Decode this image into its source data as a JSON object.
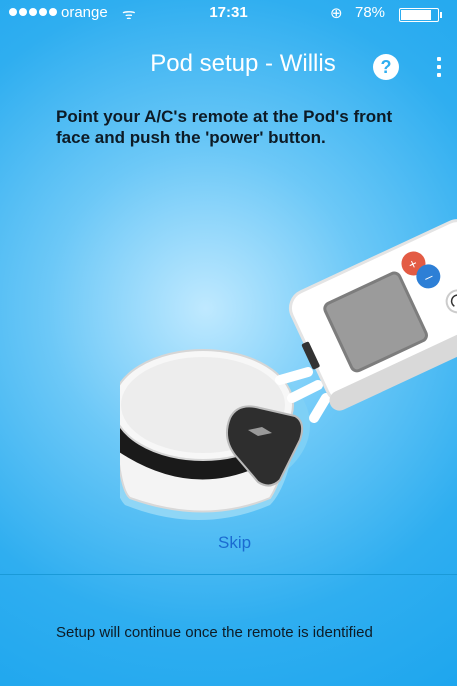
{
  "status_bar": {
    "carrier": "orange",
    "time": "17:31",
    "battery": "78%",
    "battery_level": 0.78
  },
  "header": {
    "title": "Pod setup - Willis",
    "help_label": "?"
  },
  "instruction": "Point your A/C's remote at the Pod's front face and push the 'power' button.",
  "skip_label": "Skip",
  "footer_text": "Setup will continue once the remote is identified",
  "icons": [
    "wifi-icon",
    "rotation-lock-icon",
    "battery-icon",
    "help-icon",
    "more-menu-icon"
  ]
}
